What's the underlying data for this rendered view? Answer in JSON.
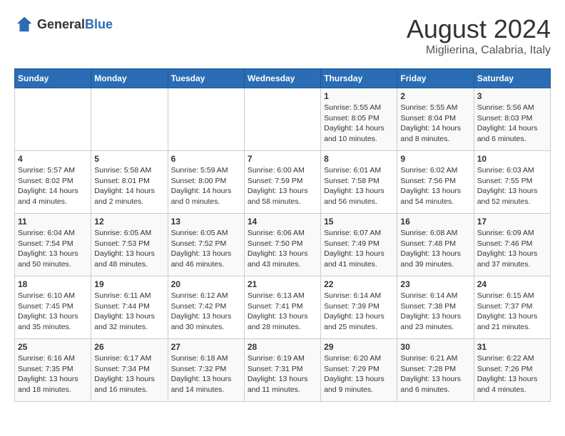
{
  "logo": {
    "general": "General",
    "blue": "Blue"
  },
  "header": {
    "month": "August 2024",
    "location": "Miglierina, Calabria, Italy"
  },
  "days_of_week": [
    "Sunday",
    "Monday",
    "Tuesday",
    "Wednesday",
    "Thursday",
    "Friday",
    "Saturday"
  ],
  "weeks": [
    [
      {
        "day": "",
        "detail": ""
      },
      {
        "day": "",
        "detail": ""
      },
      {
        "day": "",
        "detail": ""
      },
      {
        "day": "",
        "detail": ""
      },
      {
        "day": "1",
        "detail": "Sunrise: 5:55 AM\nSunset: 8:05 PM\nDaylight: 14 hours\nand 10 minutes."
      },
      {
        "day": "2",
        "detail": "Sunrise: 5:55 AM\nSunset: 8:04 PM\nDaylight: 14 hours\nand 8 minutes."
      },
      {
        "day": "3",
        "detail": "Sunrise: 5:56 AM\nSunset: 8:03 PM\nDaylight: 14 hours\nand 6 minutes."
      }
    ],
    [
      {
        "day": "4",
        "detail": "Sunrise: 5:57 AM\nSunset: 8:02 PM\nDaylight: 14 hours\nand 4 minutes."
      },
      {
        "day": "5",
        "detail": "Sunrise: 5:58 AM\nSunset: 8:01 PM\nDaylight: 14 hours\nand 2 minutes."
      },
      {
        "day": "6",
        "detail": "Sunrise: 5:59 AM\nSunset: 8:00 PM\nDaylight: 14 hours\nand 0 minutes."
      },
      {
        "day": "7",
        "detail": "Sunrise: 6:00 AM\nSunset: 7:59 PM\nDaylight: 13 hours\nand 58 minutes."
      },
      {
        "day": "8",
        "detail": "Sunrise: 6:01 AM\nSunset: 7:58 PM\nDaylight: 13 hours\nand 56 minutes."
      },
      {
        "day": "9",
        "detail": "Sunrise: 6:02 AM\nSunset: 7:56 PM\nDaylight: 13 hours\nand 54 minutes."
      },
      {
        "day": "10",
        "detail": "Sunrise: 6:03 AM\nSunset: 7:55 PM\nDaylight: 13 hours\nand 52 minutes."
      }
    ],
    [
      {
        "day": "11",
        "detail": "Sunrise: 6:04 AM\nSunset: 7:54 PM\nDaylight: 13 hours\nand 50 minutes."
      },
      {
        "day": "12",
        "detail": "Sunrise: 6:05 AM\nSunset: 7:53 PM\nDaylight: 13 hours\nand 48 minutes."
      },
      {
        "day": "13",
        "detail": "Sunrise: 6:05 AM\nSunset: 7:52 PM\nDaylight: 13 hours\nand 46 minutes."
      },
      {
        "day": "14",
        "detail": "Sunrise: 6:06 AM\nSunset: 7:50 PM\nDaylight: 13 hours\nand 43 minutes."
      },
      {
        "day": "15",
        "detail": "Sunrise: 6:07 AM\nSunset: 7:49 PM\nDaylight: 13 hours\nand 41 minutes."
      },
      {
        "day": "16",
        "detail": "Sunrise: 6:08 AM\nSunset: 7:48 PM\nDaylight: 13 hours\nand 39 minutes."
      },
      {
        "day": "17",
        "detail": "Sunrise: 6:09 AM\nSunset: 7:46 PM\nDaylight: 13 hours\nand 37 minutes."
      }
    ],
    [
      {
        "day": "18",
        "detail": "Sunrise: 6:10 AM\nSunset: 7:45 PM\nDaylight: 13 hours\nand 35 minutes."
      },
      {
        "day": "19",
        "detail": "Sunrise: 6:11 AM\nSunset: 7:44 PM\nDaylight: 13 hours\nand 32 minutes."
      },
      {
        "day": "20",
        "detail": "Sunrise: 6:12 AM\nSunset: 7:42 PM\nDaylight: 13 hours\nand 30 minutes."
      },
      {
        "day": "21",
        "detail": "Sunrise: 6:13 AM\nSunset: 7:41 PM\nDaylight: 13 hours\nand 28 minutes."
      },
      {
        "day": "22",
        "detail": "Sunrise: 6:14 AM\nSunset: 7:39 PM\nDaylight: 13 hours\nand 25 minutes."
      },
      {
        "day": "23",
        "detail": "Sunrise: 6:14 AM\nSunset: 7:38 PM\nDaylight: 13 hours\nand 23 minutes."
      },
      {
        "day": "24",
        "detail": "Sunrise: 6:15 AM\nSunset: 7:37 PM\nDaylight: 13 hours\nand 21 minutes."
      }
    ],
    [
      {
        "day": "25",
        "detail": "Sunrise: 6:16 AM\nSunset: 7:35 PM\nDaylight: 13 hours\nand 18 minutes."
      },
      {
        "day": "26",
        "detail": "Sunrise: 6:17 AM\nSunset: 7:34 PM\nDaylight: 13 hours\nand 16 minutes."
      },
      {
        "day": "27",
        "detail": "Sunrise: 6:18 AM\nSunset: 7:32 PM\nDaylight: 13 hours\nand 14 minutes."
      },
      {
        "day": "28",
        "detail": "Sunrise: 6:19 AM\nSunset: 7:31 PM\nDaylight: 13 hours\nand 11 minutes."
      },
      {
        "day": "29",
        "detail": "Sunrise: 6:20 AM\nSunset: 7:29 PM\nDaylight: 13 hours\nand 9 minutes."
      },
      {
        "day": "30",
        "detail": "Sunrise: 6:21 AM\nSunset: 7:28 PM\nDaylight: 13 hours\nand 6 minutes."
      },
      {
        "day": "31",
        "detail": "Sunrise: 6:22 AM\nSunset: 7:26 PM\nDaylight: 13 hours\nand 4 minutes."
      }
    ]
  ]
}
